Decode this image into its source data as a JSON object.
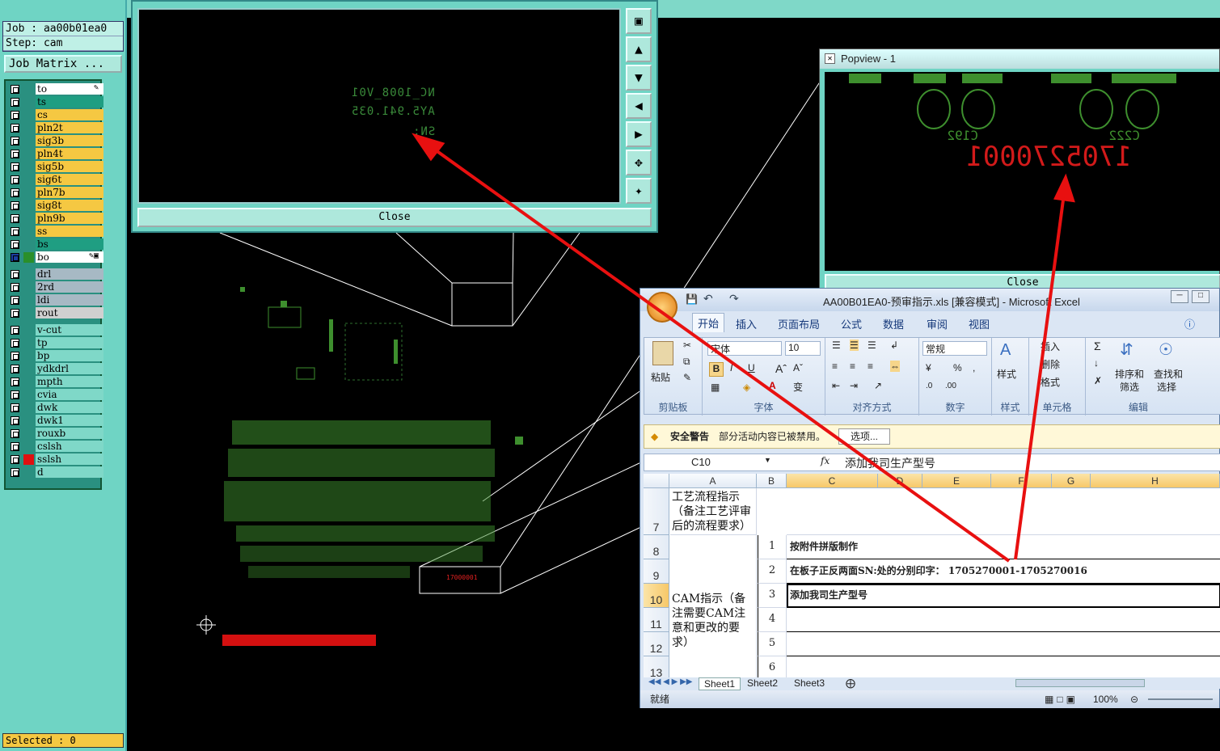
{
  "job": {
    "job_line": "Job : aa00b01ea0",
    "step_line": "Step: cam",
    "matrix_btn": "Job Matrix ..."
  },
  "layers": [
    {
      "name": "to",
      "color": "#ffffff",
      "mark": "✎"
    },
    {
      "name": "ts",
      "color": "#1f9e82"
    },
    {
      "name": "cs",
      "color": "#f5c842"
    },
    {
      "name": "pln2t",
      "color": "#f5c842"
    },
    {
      "name": "sig3b",
      "color": "#f5c842"
    },
    {
      "name": "pln4t",
      "color": "#f5c842"
    },
    {
      "name": "sig5b",
      "color": "#f5c842"
    },
    {
      "name": "sig6t",
      "color": "#f5c842"
    },
    {
      "name": "pln7b",
      "color": "#f5c842"
    },
    {
      "name": "sig8t",
      "color": "#f5c842"
    },
    {
      "name": "pln9b",
      "color": "#f5c842"
    },
    {
      "name": "ss",
      "color": "#f5c842"
    },
    {
      "name": "bs",
      "color": "#1f9e82"
    },
    {
      "name": "bo",
      "color": "#ffffff",
      "mark": "✎▣",
      "swatch": "#2a8f2a"
    },
    {
      "name": "drl",
      "color": "#a7b9c4",
      "gap": true
    },
    {
      "name": "2rd",
      "color": "#a7b9c4"
    },
    {
      "name": "ldi",
      "color": "#a7b9c4"
    },
    {
      "name": "rout",
      "color": "#d0d0d0"
    },
    {
      "name": "v-cut",
      "color": "#7fd8c8",
      "gap": true
    },
    {
      "name": "tp",
      "color": "#7fd8c8"
    },
    {
      "name": "bp",
      "color": "#7fd8c8"
    },
    {
      "name": "ydkdrl",
      "color": "#7fd8c8"
    },
    {
      "name": "mpth",
      "color": "#7fd8c8"
    },
    {
      "name": "cvia",
      "color": "#7fd8c8"
    },
    {
      "name": "dwk",
      "color": "#7fd8c8"
    },
    {
      "name": "dwk1",
      "color": "#7fd8c8"
    },
    {
      "name": "rouxb",
      "color": "#7fd8c8"
    },
    {
      "name": "cslsh",
      "color": "#7fd8c8"
    },
    {
      "name": "sslsh",
      "color": "#7fd8c8",
      "swatch": "#e01010"
    },
    {
      "name": "d",
      "color": "#7fd8c8"
    }
  ],
  "selected": "Selected : 0",
  "popup1": {
    "line1": "NC_1008_V01",
    "line2": "AY5.941.035",
    "line3": "SN:",
    "close": "Close"
  },
  "popview": {
    "title": "Popview - 1",
    "ref1": "C192",
    "ref2": "C222",
    "serial": "1705270001",
    "close": "Close"
  },
  "excel": {
    "title": "AA00B01EA0-预审指示.xls  [兼容模式] - Microsoft Excel",
    "tabs": [
      "开始",
      "插入",
      "页面布局",
      "公式",
      "数据",
      "审阅",
      "视图"
    ],
    "groups": {
      "clipboard": "剪贴板",
      "paste": "粘贴",
      "font": "字体",
      "font_name": "宋体",
      "font_size": "10",
      "align": "对齐方式",
      "number": "数字",
      "number_fmt": "常规",
      "styles": "样式",
      "cells": "单元格",
      "insert": "插入",
      "delete": "删除",
      "format": "格式",
      "editing": "编辑",
      "sort": "排序和",
      "filter": "筛选",
      "find": "查找和",
      "select": "选择"
    },
    "security_label": "安全警告",
    "security_msg": "部分活动内容已被禁用。",
    "options_btn": "选项...",
    "cell_ref": "C10",
    "fx": "fx",
    "formula": "添加我司生产型号",
    "columns": [
      "A",
      "B",
      "C",
      "D",
      "E",
      "F",
      "G",
      "H"
    ],
    "rows": [
      "7",
      "8",
      "9",
      "10",
      "11",
      "12",
      "13"
    ],
    "a7": "工艺流程指示（备注工艺评审后的流程要求）",
    "a10": "CAM指示（备注需要CAM注意和更改的要求）",
    "items": [
      {
        "n": "1",
        "text": "按附件拼版制作"
      },
      {
        "n": "2",
        "text": "在板子正反两面SN:处的分别印字： 1705270001-1705270016"
      },
      {
        "n": "3",
        "text": "添加我司生产型号"
      },
      {
        "n": "4",
        "text": ""
      },
      {
        "n": "5",
        "text": ""
      },
      {
        "n": "6",
        "text": ""
      }
    ],
    "sheets": [
      "Sheet1",
      "Sheet2",
      "Sheet3"
    ],
    "status": "就绪",
    "zoom": "100%"
  }
}
